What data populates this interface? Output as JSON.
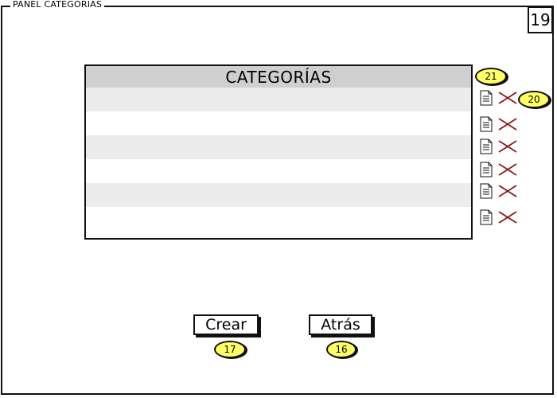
{
  "panel": {
    "title": "PANEL CATEGORIAS"
  },
  "page_number": "19",
  "table": {
    "header": "CATEGORÍAS",
    "rows": [
      "",
      "",
      "",
      "",
      "",
      ""
    ]
  },
  "row_actions": [
    {
      "edit": "edit-icon",
      "delete": "delete-icon"
    },
    {
      "edit": "edit-icon",
      "delete": "delete-icon"
    },
    {
      "edit": "edit-icon",
      "delete": "delete-icon"
    },
    {
      "edit": "edit-icon",
      "delete": "delete-icon"
    },
    {
      "edit": "edit-icon",
      "delete": "delete-icon"
    },
    {
      "edit": "edit-icon",
      "delete": "delete-icon"
    }
  ],
  "buttons": {
    "create": "Crear",
    "back": "Atrás"
  },
  "callouts": {
    "create": "17",
    "back": "16",
    "table": "21",
    "row_delete": "20"
  },
  "colors": {
    "callout": "#ffff66",
    "delete_icon": "#8b1a1a",
    "header_bg": "#cfcfcf",
    "row_alt": "#ececec"
  }
}
